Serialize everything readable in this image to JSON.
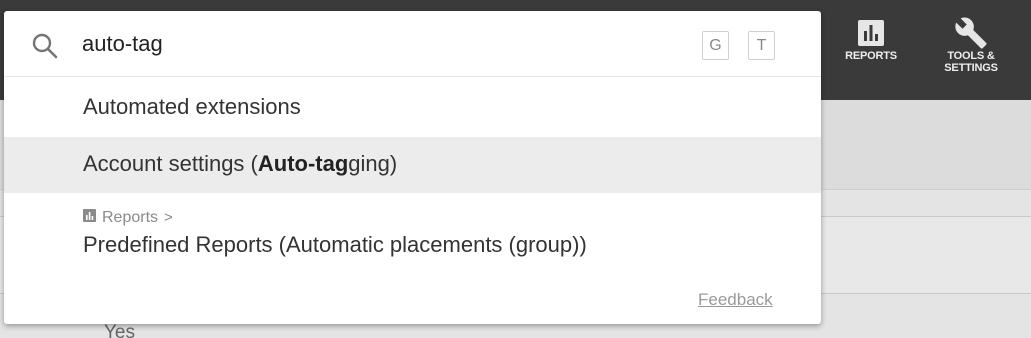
{
  "toolbar": {
    "reports": {
      "label": "REPORTS",
      "icon": "bar-chart-icon"
    },
    "tools": {
      "label": "TOOLS & SETTINGS",
      "icon": "wrench-icon"
    }
  },
  "background": {
    "visible_value": "Yes"
  },
  "search": {
    "query": "auto-tag",
    "icon": "search-icon",
    "shortcut_keys": [
      "G",
      "T"
    ]
  },
  "results": [
    {
      "label": "Automated extensions"
    },
    {
      "label_before": "Account settings (",
      "label_bold": "Auto-tag",
      "label_after": "ging)",
      "highlighted": true
    },
    {
      "breadcrumb": "Reports",
      "breadcrumb_icon": "reports-icon",
      "chevron": ">",
      "label": "Predefined Reports (Automatic placements (group))"
    }
  ],
  "feedback_link": "Feedback",
  "colors": {
    "topbar": "#3a3a3a",
    "highlight_row": "#ececec",
    "panel": "#ffffff"
  }
}
